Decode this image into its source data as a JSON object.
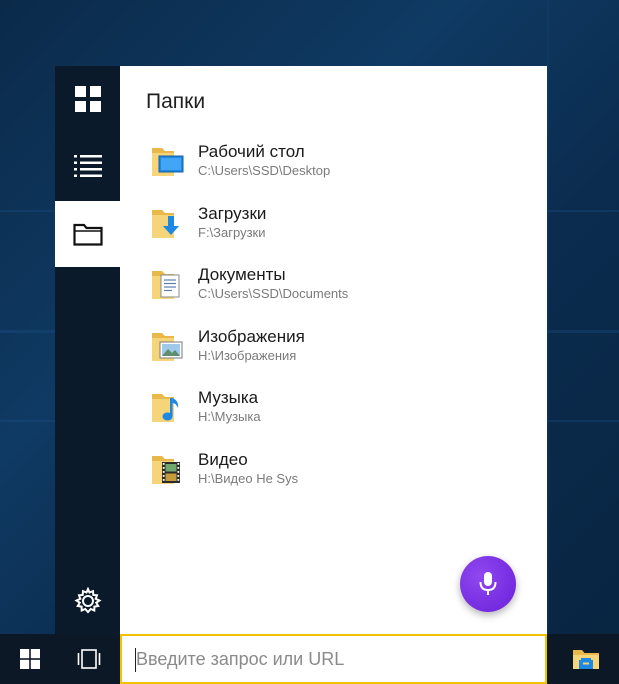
{
  "panel": {
    "title": "Папки"
  },
  "folders": [
    {
      "name": "Рабочий стол",
      "path": "C:\\Users\\SSD\\Desktop",
      "icon": "desktop-folder-icon"
    },
    {
      "name": "Загрузки",
      "path": "F:\\Загрузки",
      "icon": "downloads-folder-icon"
    },
    {
      "name": "Документы",
      "path": "C:\\Users\\SSD\\Documents",
      "icon": "documents-folder-icon"
    },
    {
      "name": "Изображения",
      "path": "H:\\Изображения",
      "icon": "pictures-folder-icon"
    },
    {
      "name": "Музыка",
      "path": "H:\\Музыка",
      "icon": "music-folder-icon"
    },
    {
      "name": "Видео",
      "path": "H:\\Видео Не Sys",
      "icon": "video-folder-icon"
    }
  ],
  "rail": {
    "items": [
      {
        "icon": "tiles-grid-icon",
        "active": false
      },
      {
        "icon": "list-icon",
        "active": false
      },
      {
        "icon": "folder-outline-icon",
        "active": true
      }
    ],
    "settings_icon": "gear-icon"
  },
  "search": {
    "placeholder": "Введите запрос или URL",
    "value": ""
  },
  "taskbar": {
    "start_icon": "windows-logo-icon",
    "task_view_icon": "task-view-icon",
    "explorer_icon": "file-explorer-icon"
  },
  "colors": {
    "accent_mic": "#7a30e6",
    "search_border": "#f2c200",
    "rail_bg": "#0a1a2b",
    "taskbar_bg": "#0d1826"
  }
}
